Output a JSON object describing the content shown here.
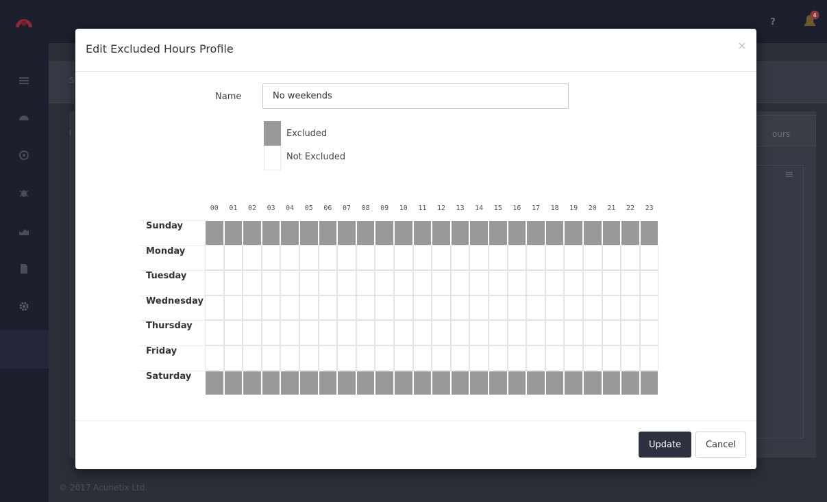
{
  "app": {
    "notification_count": "4",
    "help_glyph": "?",
    "footer_text": "© 2017 Acunetix Ltd.",
    "bg_tab_text": "ours",
    "bg_menu_glyph": "≡",
    "bg_crumb_char": "S",
    "bg_side_char": "I",
    "sidebar_icons": [
      "list-icon",
      "dashboard-icon",
      "target-icon",
      "bug-icon",
      "chart-icon",
      "report-icon",
      "settings-icon"
    ]
  },
  "modal": {
    "title": "Edit Excluded Hours Profile",
    "close_glyph": "×",
    "name_label": "Name",
    "name_value": "No weekends",
    "legend": {
      "excluded": "Excluded",
      "not_excluded": "Not Excluded"
    },
    "hours": [
      "00",
      "01",
      "02",
      "03",
      "04",
      "05",
      "06",
      "07",
      "08",
      "09",
      "10",
      "11",
      "12",
      "13",
      "14",
      "15",
      "16",
      "17",
      "18",
      "19",
      "20",
      "21",
      "22",
      "23"
    ],
    "days": [
      {
        "name": "Sunday",
        "excluded_hours": [
          0,
          1,
          2,
          3,
          4,
          5,
          6,
          7,
          8,
          9,
          10,
          11,
          12,
          13,
          14,
          15,
          16,
          17,
          18,
          19,
          20,
          21,
          22,
          23
        ]
      },
      {
        "name": "Monday",
        "excluded_hours": []
      },
      {
        "name": "Tuesday",
        "excluded_hours": []
      },
      {
        "name": "Wednesday",
        "excluded_hours": []
      },
      {
        "name": "Thursday",
        "excluded_hours": []
      },
      {
        "name": "Friday",
        "excluded_hours": []
      },
      {
        "name": "Saturday",
        "excluded_hours": [
          0,
          1,
          2,
          3,
          4,
          5,
          6,
          7,
          8,
          9,
          10,
          11,
          12,
          13,
          14,
          15,
          16,
          17,
          18,
          19,
          20,
          21,
          22,
          23
        ]
      }
    ],
    "buttons": {
      "update": "Update",
      "cancel": "Cancel"
    }
  },
  "colors": {
    "excluded": "#999999",
    "not_excluded": "#ffffff",
    "primary_button": "#2d3140",
    "brand_logo": "#e0434b",
    "badge": "#e0434b"
  }
}
